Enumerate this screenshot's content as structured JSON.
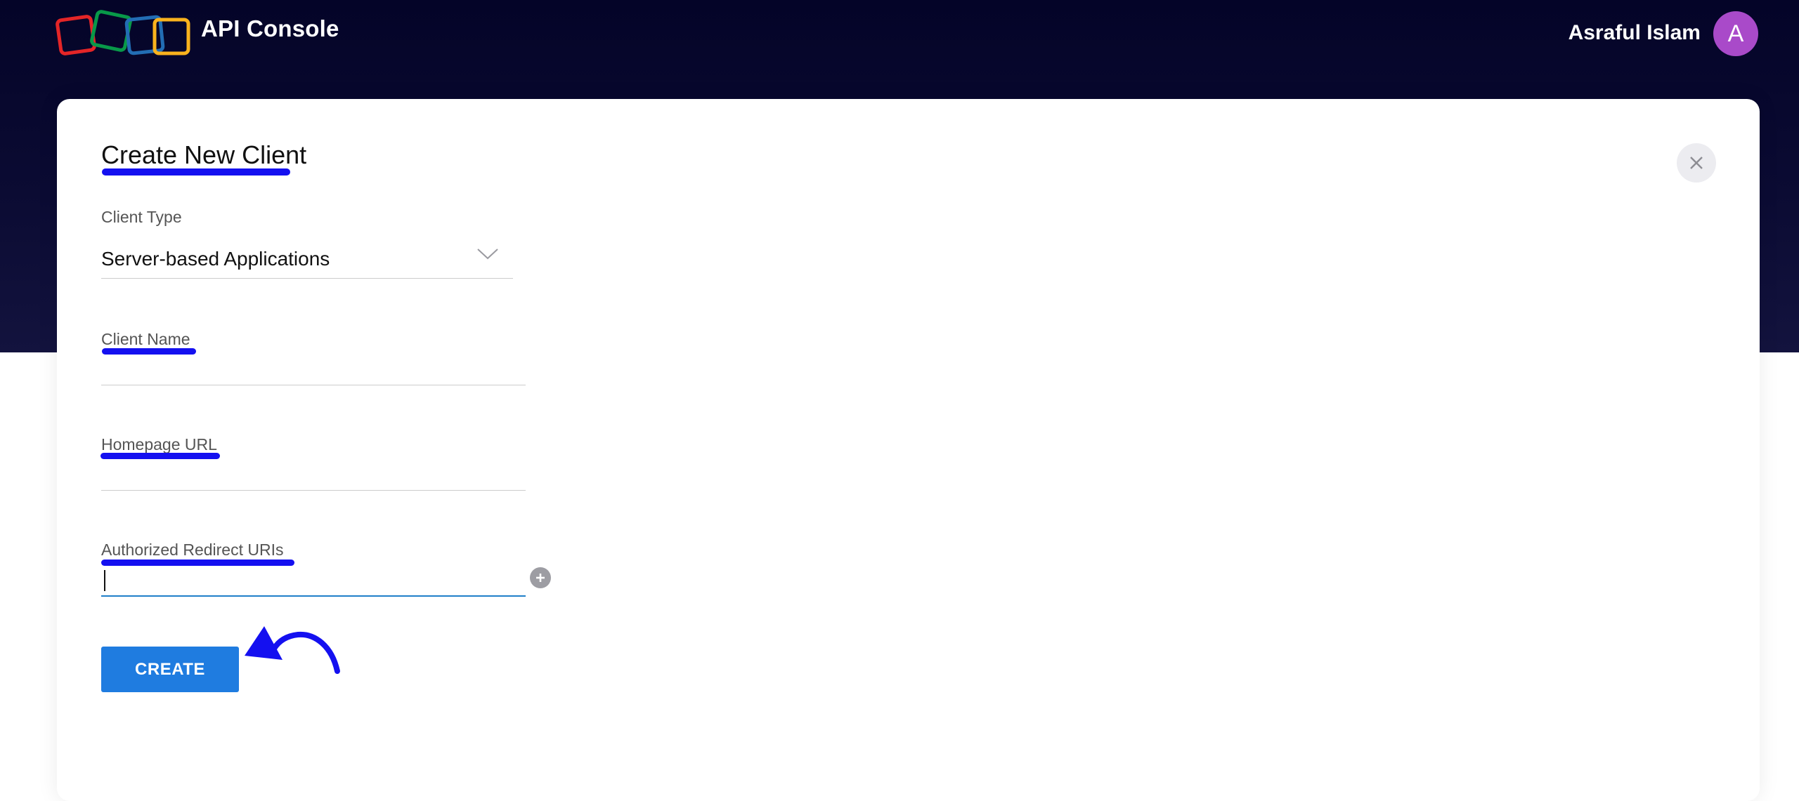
{
  "header": {
    "app_title": "API Console",
    "user_name": "Asraful Islam",
    "avatar_letter": "A"
  },
  "form": {
    "title": "Create New Client",
    "client_type_label": "Client Type",
    "client_type_value": "Server-based Applications",
    "client_name_label": "Client Name",
    "client_name_value": "",
    "homepage_url_label": "Homepage URL",
    "homepage_url_value": "",
    "redirect_uris_label": "Authorized Redirect URIs",
    "redirect_uris_value": "",
    "create_label": "CREATE"
  },
  "icons": {
    "close": "close-icon",
    "chevron": "chevron-down-icon",
    "add": "plus-circle-icon",
    "logo": "zoho-logo"
  },
  "colors": {
    "header_bg": "#040428",
    "avatar": "#a94ac9",
    "primary_button": "#1f7ce0",
    "focus_underline": "#1f7fc9",
    "annotation": "#1410f0"
  }
}
